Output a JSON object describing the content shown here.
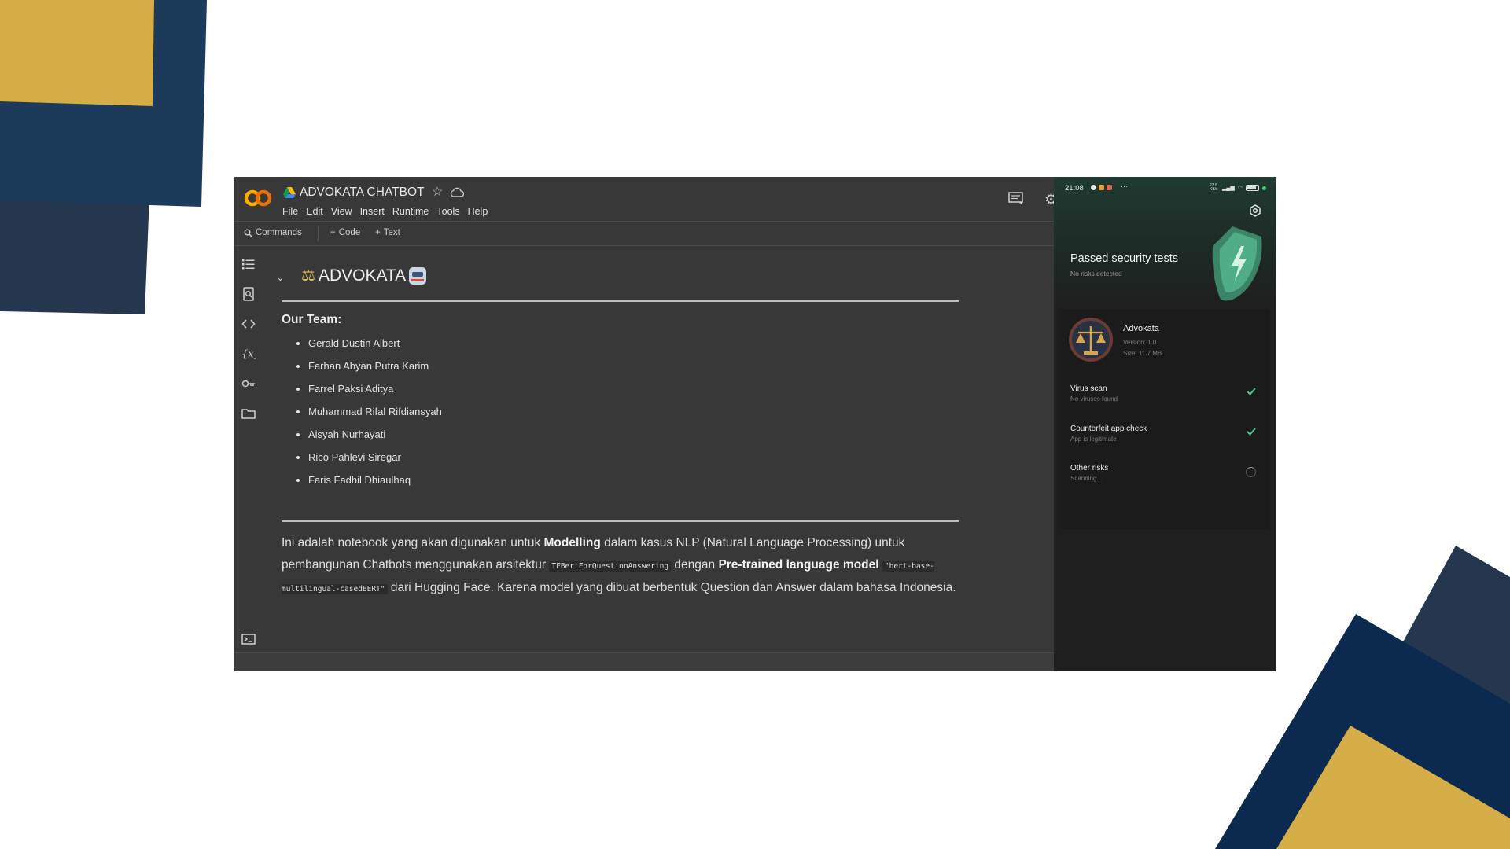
{
  "colab": {
    "title": "ADVOKATA CHATBOT",
    "menu": [
      "File",
      "Edit",
      "View",
      "Insert",
      "Runtime",
      "Tools",
      "Help"
    ],
    "toolbar": {
      "commands_label": "Commands",
      "code_label": "Code",
      "text_label": "Text"
    },
    "notebook": {
      "heading": "ADVOKATA",
      "team_title": "Our Team:",
      "team_members": [
        "Gerald Dustin Albert",
        "Farhan Abyan Putra Karim",
        "Farrel Paksi Aditya",
        "Muhammad Rifal Rifdiansyah",
        "Aisyah Nurhayati",
        "Rico Pahlevi Siregar",
        "Faris Fadhil Dhiaulhaq"
      ],
      "description": {
        "part1": "Ini adalah notebook yang akan digunakan untuk ",
        "bold1": "Modelling",
        "part2": " dalam kasus NLP (Natural Language Processing) untuk pembangunan Chatbots menggunakan arsitektur ",
        "code1": "TFBertForQuestionAnswering",
        "part3": " dengan ",
        "bold2": "Pre-trained language model",
        "part4": " ",
        "code2": "\"bert-base-multilingual-casedBERT\"",
        "part5": " dari Hugging Face. Karena model yang dibuat berbentuk Question dan Answer dalam bahasa Indonesia."
      }
    }
  },
  "phone": {
    "status_time": "21:08",
    "status_more": "···",
    "status_network": "23.8 KB/s",
    "battery": "86",
    "banner_title": "Passed security tests",
    "banner_subtitle": "No risks detected",
    "app": {
      "name": "Advokata",
      "version": "Version: 1.0",
      "size": "Size: 11.7 MB"
    },
    "checks": [
      {
        "title": "Virus scan",
        "subtitle": "No viruses found",
        "status": "check-icon"
      },
      {
        "title": "Counterfeit app check",
        "subtitle": "App is legitimate",
        "status": "check-icon"
      },
      {
        "title": "Other risks",
        "subtitle": "Scanning...",
        "status": "spinner-icon"
      }
    ]
  },
  "colors": {
    "slide_gold": "#d6ae47",
    "slide_navy": "#1c3a5a",
    "slide_dark_navy": "#0c2a4f",
    "slide_slate": "#24374f",
    "colab_bg": "#383838",
    "accent_green": "#4cc38a"
  }
}
